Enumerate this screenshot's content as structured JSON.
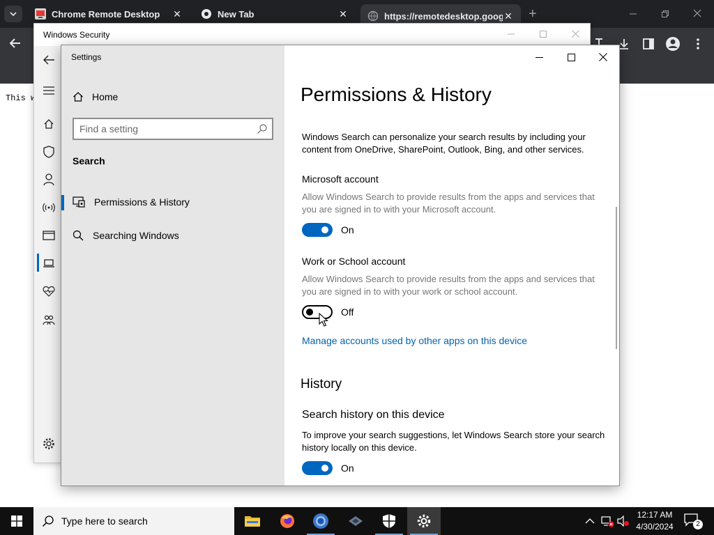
{
  "browser": {
    "tabs": [
      {
        "label": "Chrome Remote Desktop",
        "icon": "chrome-remote-desktop-icon"
      },
      {
        "label": "New Tab",
        "icon": "globe-icon"
      },
      {
        "label": "https://remotedesktop.google.",
        "icon": "globe-icon"
      }
    ],
    "close_glyph": "✕",
    "new_tab_glyph": "+",
    "page_text": "This w"
  },
  "security_window": {
    "title": "Windows Security",
    "nav_icons": [
      "back-arrow-icon",
      "hamburger-menu-icon",
      "home-icon",
      "shield-icon",
      "person-icon",
      "wireless-icon",
      "browser-window-icon",
      "laptop-icon",
      "heart-pulse-icon",
      "family-icon",
      "gear-icon"
    ]
  },
  "settings": {
    "app_title": "Settings",
    "home_label": "Home",
    "search_placeholder": "Find a setting",
    "section_label": "Search",
    "nav": [
      {
        "label": "Permissions & History",
        "selected": true
      },
      {
        "label": "Searching Windows",
        "selected": false
      }
    ],
    "page_title": "Permissions & History",
    "intro": "Windows Search can personalize your search results by including your content from OneDrive, SharePoint, Outlook, Bing, and other services.",
    "microsoft_account": {
      "title": "Microsoft account",
      "desc": "Allow Windows Search to provide results from the apps and services that you are signed in to with your Microsoft account.",
      "state": "On"
    },
    "work_account": {
      "title": "Work or School account",
      "desc": "Allow Windows Search to provide results from the apps and services that you are signed in to with your work or school account.",
      "state": "Off"
    },
    "manage_link": "Manage accounts used by other apps on this device",
    "history": {
      "title": "History",
      "device_title": "Search history on this device",
      "device_desc": "To improve your search suggestions, let Windows Search store your search history locally on this device.",
      "state": "On"
    }
  },
  "taskbar": {
    "search_text": "Type here to search",
    "time": "12:17 AM",
    "date": "4/30/2024",
    "notifications": "2"
  },
  "colors": {
    "accent": "#0067c0",
    "link": "#0063b1",
    "chrome_dark": "#202124"
  }
}
